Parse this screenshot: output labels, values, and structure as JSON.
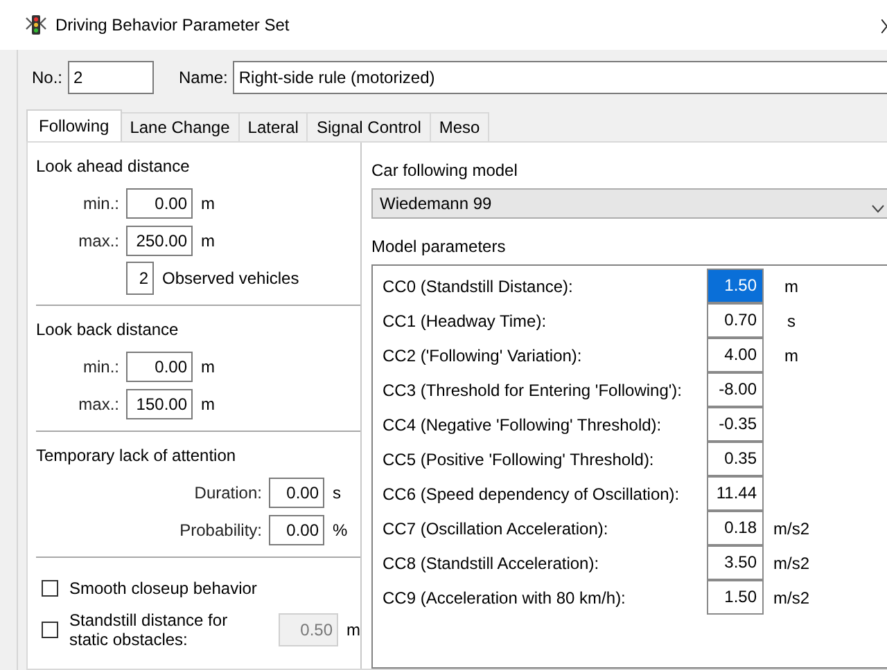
{
  "window": {
    "title": "Driving Behavior Parameter Set"
  },
  "header": {
    "number_label": "No.:",
    "number": "2",
    "name_label": "Name:",
    "name": "Right-side rule (motorized)"
  },
  "tabs": [
    {
      "label": "Following",
      "selected": true
    },
    {
      "label": "Lane Change",
      "selected": false
    },
    {
      "label": "Lateral",
      "selected": false
    },
    {
      "label": "Signal Control",
      "selected": false
    },
    {
      "label": "Meso",
      "selected": false
    }
  ],
  "look_ahead": {
    "title": "Look ahead distance",
    "fields": [
      {
        "label": "min.:",
        "value": "0.00",
        "unit": "m"
      },
      {
        "label": "max.:",
        "value": "250.00",
        "unit": "m"
      }
    ],
    "observed_vehicles": {
      "value": "2",
      "label": "Observed vehicles"
    }
  },
  "look_back": {
    "title": "Look back distance",
    "fields": [
      {
        "label": "min.:",
        "value": "0.00",
        "unit": "m"
      },
      {
        "label": "max.:",
        "value": "150.00",
        "unit": "m"
      }
    ]
  },
  "attention": {
    "title": "Temporary lack of attention",
    "fields": [
      {
        "label": "Duration:",
        "value": "0.00",
        "unit": "s"
      },
      {
        "label": "Probability:",
        "value": "0.00",
        "unit": "%"
      }
    ]
  },
  "options": [
    {
      "kind": "checkbox",
      "label": "Smooth closeup behavior",
      "checked": false
    },
    {
      "kind": "checkbox-field",
      "label": "Standstill distance for static obstacles:",
      "checked": false,
      "value": "0.50",
      "unit": "m",
      "disabled": true
    }
  ],
  "model": {
    "label": "Car following model",
    "value": "Wiedemann 99"
  },
  "parameters": {
    "title": "Model parameters",
    "rows": [
      {
        "label": "CC0 (Standstill Distance):",
        "value": "1.50",
        "unit": "m",
        "selected": true
      },
      {
        "label": "CC1 (Headway Time):",
        "value": "0.70",
        "unit": "s",
        "selected": false
      },
      {
        "label": "CC2 ('Following' Variation):",
        "value": "4.00",
        "unit": "m",
        "selected": false
      },
      {
        "label": "CC3 (Threshold for Entering 'Following'):",
        "value": "-8.00",
        "selected": false
      },
      {
        "label": "CC4 (Negative 'Following' Threshold):",
        "value": "-0.35",
        "selected": false
      },
      {
        "label": "CC5 (Positive 'Following' Threshold):",
        "value": "0.35",
        "selected": false
      },
      {
        "label": "CC6 (Speed dependency of Oscillation):",
        "value": "11.44",
        "selected": false
      },
      {
        "label": "CC7 (Oscillation Acceleration):",
        "value": "0.18",
        "unit": "m/s2",
        "selected": false
      },
      {
        "label": "CC8 (Standstill Acceleration):",
        "value": "3.50",
        "unit": "m/s2",
        "selected": false
      },
      {
        "label": "CC9 (Acceleration with 80 km/h):",
        "value": "1.50",
        "unit": "m/s2",
        "selected": false
      }
    ]
  }
}
